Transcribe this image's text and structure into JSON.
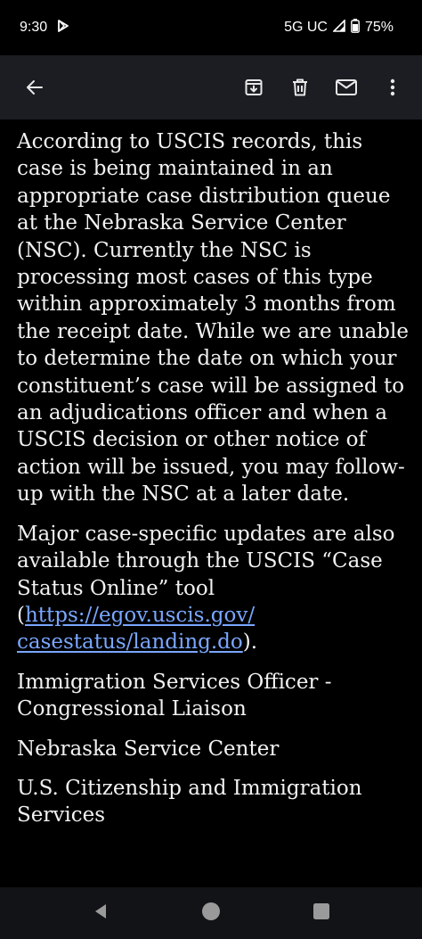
{
  "status_bar": {
    "time": "9:30",
    "network": "5G UC",
    "battery": "75%",
    "icons": [
      "play-store-icon",
      "signal-icon",
      "battery-icon"
    ]
  },
  "app_bar": {
    "icons": [
      "back-arrow-icon",
      "archive-icon",
      "delete-icon",
      "mark-unread-icon",
      "more-vert-icon"
    ]
  },
  "email": {
    "paragraph_1": "According to USCIS records, this case is being maintained in an appropriate case distribution queue at the Nebraska Service Center (NSC). Currently the NSC is processing most cases of this type within approximately 3 months from the receipt date. While we are unable to determine the date on which your constituent’s case will be assigned to an adjudications officer and when a USCIS decision or other notice of action will be issued, you may follow-up with the NSC at a later date.",
    "paragraph_2_text": "Major case-specific updates are also available through the USCIS “Case Status Online” tool",
    "paragraph_2_open": "(",
    "link_line_1": "https://egov.uscis.gov/",
    "link_line_2": "casestatus/landing.do",
    "paragraph_2_close": ").",
    "signature_title_line_1": "Immigration Services Officer -",
    "signature_title_line_2": "Congressional Liaison",
    "signature_office": "Nebraska Service Center",
    "signature_agency_line_1": "U.S. Citizenship and Immigration",
    "signature_agency_line_2": "Services"
  },
  "nav_bar": {
    "icons": [
      "nav-back-icon",
      "nav-home-icon",
      "nav-recents-icon"
    ]
  },
  "colors": {
    "background": "#000000",
    "app_bar": "#1b1d22",
    "text": "#f2f2f2",
    "link": "#7aa7ff"
  }
}
